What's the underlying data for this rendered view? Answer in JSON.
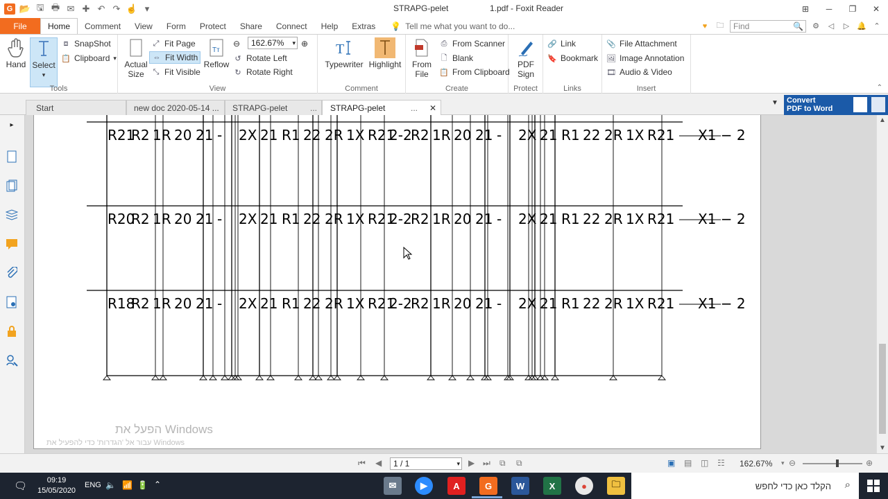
{
  "window": {
    "doc_title": "STRAPG-pelet",
    "doc_title_right": "1.pdf - Foxit Reader",
    "app_logo": "G"
  },
  "ribbon_tabs": [
    "File",
    "Home",
    "Comment",
    "View",
    "Form",
    "Protect",
    "Share",
    "Connect",
    "Help",
    "Extras"
  ],
  "tell_me": "Tell me what you want to do...",
  "find_placeholder": "Find",
  "ribbon": {
    "tools": {
      "hand": "Hand",
      "select": "Select",
      "snapshot": "SnapShot",
      "clipboard": "Clipboard",
      "label": "Tools"
    },
    "view": {
      "actual_size": "Actual Size",
      "fit_page": "Fit Page",
      "fit_width": "Fit Width",
      "fit_visible": "Fit Visible",
      "reflow": "Reflow",
      "zoom_value": "162.67%",
      "rotate_left": "Rotate Left",
      "rotate_right": "Rotate Right",
      "label": "View"
    },
    "comment": {
      "typewriter": "Typewriter",
      "highlight": "Highlight",
      "label": "Comment"
    },
    "create": {
      "from_file": "From File",
      "from_scanner": "From Scanner",
      "blank": "Blank",
      "from_clipboard": "From Clipboard",
      "label": "Create"
    },
    "protect": {
      "pdf_sign": "PDF Sign",
      "label": "Protect"
    },
    "links": {
      "link": "Link",
      "bookmark": "Bookmark",
      "label": "Links"
    },
    "insert": {
      "file_attachment": "File Attachment",
      "image_annotation": "Image Annotation",
      "audio_video": "Audio & Video",
      "label": "Insert"
    }
  },
  "doc_tabs": [
    "Start",
    "new doc 2020-05-14 ...",
    "STRAPG-pelet",
    "STRAPG-pelet"
  ],
  "doc_tab_more": "...",
  "convert_banner": {
    "line1": "Convert",
    "line2": "PDF to Word"
  },
  "drawing": {
    "levels": [
      {
        "main_label": "R21",
        "end_label": "X1 − 2"
      },
      {
        "main_label": "R20",
        "end_label": "X1 − 2"
      },
      {
        "main_label": "R18",
        "end_label": "X1 − 2"
      }
    ]
  },
  "watermark": {
    "line1": "הפעל את Windows",
    "line2": "עבור אל 'הגדרות' כדי להפעיל את Windows"
  },
  "status": {
    "page": "1 / 1",
    "zoom": "162.67%"
  },
  "taskbar": {
    "time": "09:19",
    "date": "15/05/2020",
    "lang": "ENG",
    "search_text": "הקלד כאן כדי לחפש",
    "apps": [
      "xmind",
      "zoom",
      "acrobat",
      "foxit",
      "word",
      "excel",
      "chrome",
      "explorer"
    ]
  },
  "colors": {
    "accent": "#f26c1f",
    "ribbon_select": "#cde6f7",
    "taskbar": "#1d2430",
    "convert": "#1b5aa8"
  }
}
